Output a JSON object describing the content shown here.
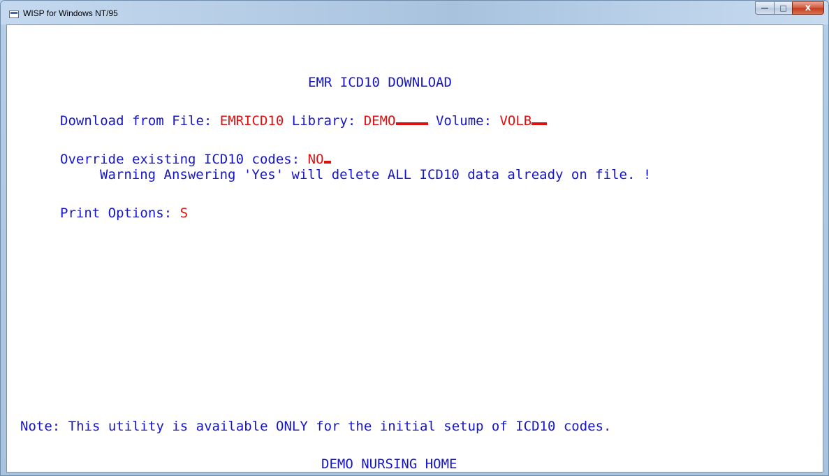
{
  "window": {
    "title": "WISP for Windows NT/95",
    "controls": {
      "minimize": "—",
      "maximize": "□",
      "close": "x"
    }
  },
  "screen": {
    "heading": "EMR ICD10 DOWNLOAD",
    "download": {
      "file_label": "Download from File:",
      "file_value": "EMRICD10",
      "library_label": "Library:",
      "library_value": "DEMO",
      "volume_label": "Volume:",
      "volume_value": "VOLB"
    },
    "override": {
      "label": "Override existing ICD10 codes:",
      "value": "NO"
    },
    "warning": "Warning Answering 'Yes' will delete ALL ICD10 data already on file. !",
    "print": {
      "label": "Print Options:",
      "value": "S"
    },
    "note": "Note: This utility is available ONLY for the initial setup of ICD10 codes.",
    "footer": "DEMO NURSING HOME"
  },
  "colors": {
    "text": "#1616c6",
    "field": "#e01010",
    "background": "#ffffff"
  }
}
